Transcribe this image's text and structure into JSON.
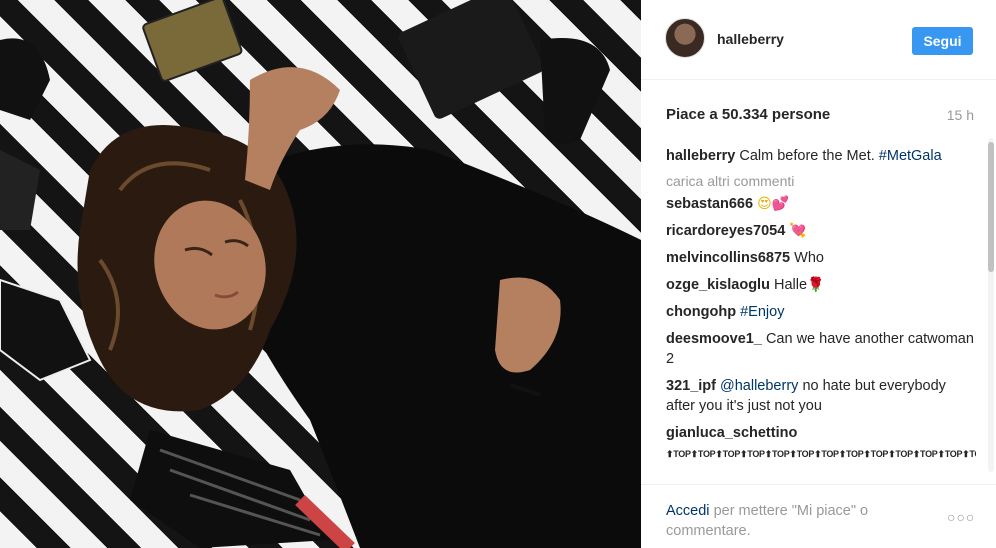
{
  "post": {
    "username": "halleberry",
    "follow_label": "Segui",
    "likes_text": "Piace a 50.334 persone",
    "time_ago": "15 h",
    "caption": {
      "user": "halleberry",
      "text": "Calm before the Met.",
      "hashtag": "#MetGala"
    },
    "load_more": "carica altri commenti",
    "comments": [
      {
        "user": "sebastan666",
        "text": "",
        "emoji": "😍💕"
      },
      {
        "user": "ricardoreyes7054",
        "text": "",
        "emoji": "💘"
      },
      {
        "user": "melvincollins6875",
        "text": "Who",
        "emoji": ""
      },
      {
        "user": "ozge_kislaoglu",
        "text": "Halle",
        "emoji": "🌹"
      },
      {
        "user": "chongohp",
        "text": "",
        "hashtag": "#Enjoy"
      },
      {
        "user": "deesmoove1_",
        "text": "Can we have another catwoman 2"
      },
      {
        "user": "321_ipf",
        "mention": "@halleberry",
        "text": "no hate but everybody after you it's just not you"
      },
      {
        "user": "gianluca_schettino",
        "text": "⬆TOP⬆TOP⬆TOP⬆TOP⬆TOP⬆TOP⬆TOP⬆TOP⬆TOP⬆TOP⬆TOP⬆TOP⬆TOP⬆TOP⬆TOP⬆TOP"
      }
    ],
    "footer": {
      "login_link": "Accedi",
      "rest": "per mettere \"Mi piace\" o commentare.",
      "more_label": "○○○"
    },
    "colors": {
      "accent": "#3897f0",
      "link": "#003569",
      "muted": "#999999"
    }
  }
}
